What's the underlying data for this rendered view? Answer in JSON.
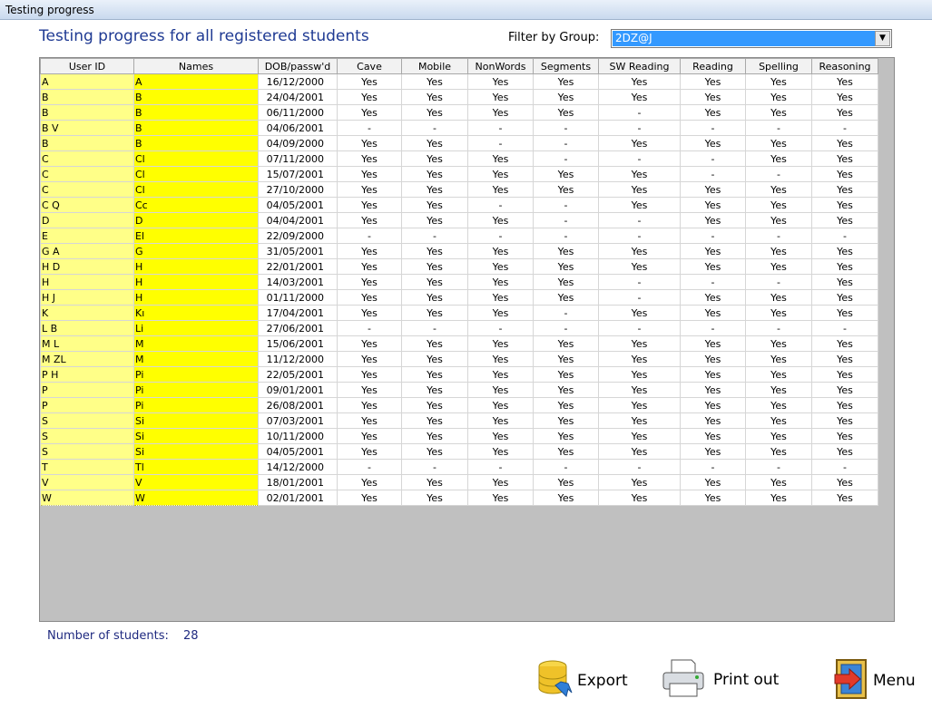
{
  "window": {
    "title": "Testing progress"
  },
  "heading": "Testing progress for all registered students",
  "filter": {
    "label": "Filter by Group:",
    "value": "2DZ@J"
  },
  "grid": {
    "columns": [
      "User ID",
      "Names",
      "DOB/passw'd",
      "Cave",
      "Mobile",
      "NonWords",
      "Segments",
      "SW Reading",
      "Reading",
      "Spelling",
      "Reasoning"
    ],
    "rows": [
      {
        "uid": "A",
        "name": "A",
        "dob": "16/12/2000",
        "r": [
          "Yes",
          "Yes",
          "Yes",
          "Yes",
          "Yes",
          "Yes",
          "Yes",
          "Yes"
        ]
      },
      {
        "uid": "B",
        "name": "B",
        "dob": "24/04/2001",
        "r": [
          "Yes",
          "Yes",
          "Yes",
          "Yes",
          "Yes",
          "Yes",
          "Yes",
          "Yes"
        ]
      },
      {
        "uid": "B",
        "name": "B",
        "dob": "06/11/2000",
        "r": [
          "Yes",
          "Yes",
          "Yes",
          "Yes",
          "-",
          "Yes",
          "Yes",
          "Yes"
        ]
      },
      {
        "uid": "B            V",
        "name": "B",
        "dob": "04/06/2001",
        "r": [
          "-",
          "-",
          "-",
          "-",
          "-",
          "-",
          "-",
          "-"
        ]
      },
      {
        "uid": "B",
        "name": "B",
        "dob": "04/09/2000",
        "r": [
          "Yes",
          "Yes",
          "-",
          "-",
          "Yes",
          "Yes",
          "Yes",
          "Yes"
        ]
      },
      {
        "uid": "C",
        "name": "Cl",
        "dob": "07/11/2000",
        "r": [
          "Yes",
          "Yes",
          "Yes",
          "-",
          "-",
          "-",
          "Yes",
          "Yes"
        ]
      },
      {
        "uid": "C",
        "name": "Cl",
        "dob": "15/07/2001",
        "r": [
          "Yes",
          "Yes",
          "Yes",
          "Yes",
          "Yes",
          "-",
          "-",
          "Yes"
        ]
      },
      {
        "uid": "C",
        "name": "Cl",
        "dob": "27/10/2000",
        "r": [
          "Yes",
          "Yes",
          "Yes",
          "Yes",
          "Yes",
          "Yes",
          "Yes",
          "Yes"
        ]
      },
      {
        "uid": "C            Q",
        "name": "Cc",
        "dob": "04/05/2001",
        "r": [
          "Yes",
          "Yes",
          "-",
          "-",
          "Yes",
          "Yes",
          "Yes",
          "Yes"
        ]
      },
      {
        "uid": "D",
        "name": "D",
        "dob": "04/04/2001",
        "r": [
          "Yes",
          "Yes",
          "Yes",
          "-",
          "-",
          "Yes",
          "Yes",
          "Yes"
        ]
      },
      {
        "uid": "E",
        "name": "El",
        "dob": "22/09/2000",
        "r": [
          "-",
          "-",
          "-",
          "-",
          "-",
          "-",
          "-",
          "-"
        ]
      },
      {
        "uid": "G            A",
        "name": "G",
        "dob": "31/05/2001",
        "r": [
          "Yes",
          "Yes",
          "Yes",
          "Yes",
          "Yes",
          "Yes",
          "Yes",
          "Yes"
        ]
      },
      {
        "uid": "H            D",
        "name": "H",
        "dob": "22/01/2001",
        "r": [
          "Yes",
          "Yes",
          "Yes",
          "Yes",
          "Yes",
          "Yes",
          "Yes",
          "Yes"
        ]
      },
      {
        "uid": "H",
        "name": "H",
        "dob": "14/03/2001",
        "r": [
          "Yes",
          "Yes",
          "Yes",
          "Yes",
          "-",
          "-",
          "-",
          "Yes"
        ]
      },
      {
        "uid": "H            J",
        "name": "H",
        "dob": "01/11/2000",
        "r": [
          "Yes",
          "Yes",
          "Yes",
          "Yes",
          "-",
          "Yes",
          "Yes",
          "Yes"
        ]
      },
      {
        "uid": "K",
        "name": "Kı",
        "dob": "17/04/2001",
        "r": [
          "Yes",
          "Yes",
          "Yes",
          "-",
          "Yes",
          "Yes",
          "Yes",
          "Yes"
        ]
      },
      {
        "uid": "L            B",
        "name": "Li",
        "dob": "27/06/2001",
        "r": [
          "-",
          "-",
          "-",
          "-",
          "-",
          "-",
          "-",
          "-"
        ]
      },
      {
        "uid": "M            L",
        "name": "M",
        "dob": "15/06/2001",
        "r": [
          "Yes",
          "Yes",
          "Yes",
          "Yes",
          "Yes",
          "Yes",
          "Yes",
          "Yes"
        ]
      },
      {
        "uid": "M           ZL",
        "name": "M",
        "dob": "11/12/2000",
        "r": [
          "Yes",
          "Yes",
          "Yes",
          "Yes",
          "Yes",
          "Yes",
          "Yes",
          "Yes"
        ]
      },
      {
        "uid": "P            H",
        "name": "Pi",
        "dob": "22/05/2001",
        "r": [
          "Yes",
          "Yes",
          "Yes",
          "Yes",
          "Yes",
          "Yes",
          "Yes",
          "Yes"
        ]
      },
      {
        "uid": "P",
        "name": "Pi",
        "dob": "09/01/2001",
        "r": [
          "Yes",
          "Yes",
          "Yes",
          "Yes",
          "Yes",
          "Yes",
          "Yes",
          "Yes"
        ]
      },
      {
        "uid": "P",
        "name": "Pi",
        "dob": "26/08/2001",
        "r": [
          "Yes",
          "Yes",
          "Yes",
          "Yes",
          "Yes",
          "Yes",
          "Yes",
          "Yes"
        ]
      },
      {
        "uid": "S",
        "name": "Si",
        "dob": "07/03/2001",
        "r": [
          "Yes",
          "Yes",
          "Yes",
          "Yes",
          "Yes",
          "Yes",
          "Yes",
          "Yes"
        ]
      },
      {
        "uid": "S",
        "name": "Si",
        "dob": "10/11/2000",
        "r": [
          "Yes",
          "Yes",
          "Yes",
          "Yes",
          "Yes",
          "Yes",
          "Yes",
          "Yes"
        ]
      },
      {
        "uid": "S",
        "name": "Si",
        "dob": "04/05/2001",
        "r": [
          "Yes",
          "Yes",
          "Yes",
          "Yes",
          "Yes",
          "Yes",
          "Yes",
          "Yes"
        ]
      },
      {
        "uid": "T",
        "name": "Tl",
        "dob": "14/12/2000",
        "r": [
          "-",
          "-",
          "-",
          "-",
          "-",
          "-",
          "-",
          "-"
        ]
      },
      {
        "uid": "V",
        "name": "V",
        "dob": "18/01/2001",
        "r": [
          "Yes",
          "Yes",
          "Yes",
          "Yes",
          "Yes",
          "Yes",
          "Yes",
          "Yes"
        ]
      },
      {
        "uid": "W",
        "name": "W",
        "dob": "02/01/2001",
        "r": [
          "Yes",
          "Yes",
          "Yes",
          "Yes",
          "Yes",
          "Yes",
          "Yes",
          "Yes"
        ]
      }
    ]
  },
  "footer": {
    "count_label": "Number of students:",
    "count_value": "28"
  },
  "buttons": {
    "export": {
      "label": "Export",
      "icon": "database-export-icon"
    },
    "print": {
      "label": "Print out",
      "icon": "printer-icon"
    },
    "menu": {
      "label": "Menu",
      "icon": "exit-door-icon"
    }
  }
}
